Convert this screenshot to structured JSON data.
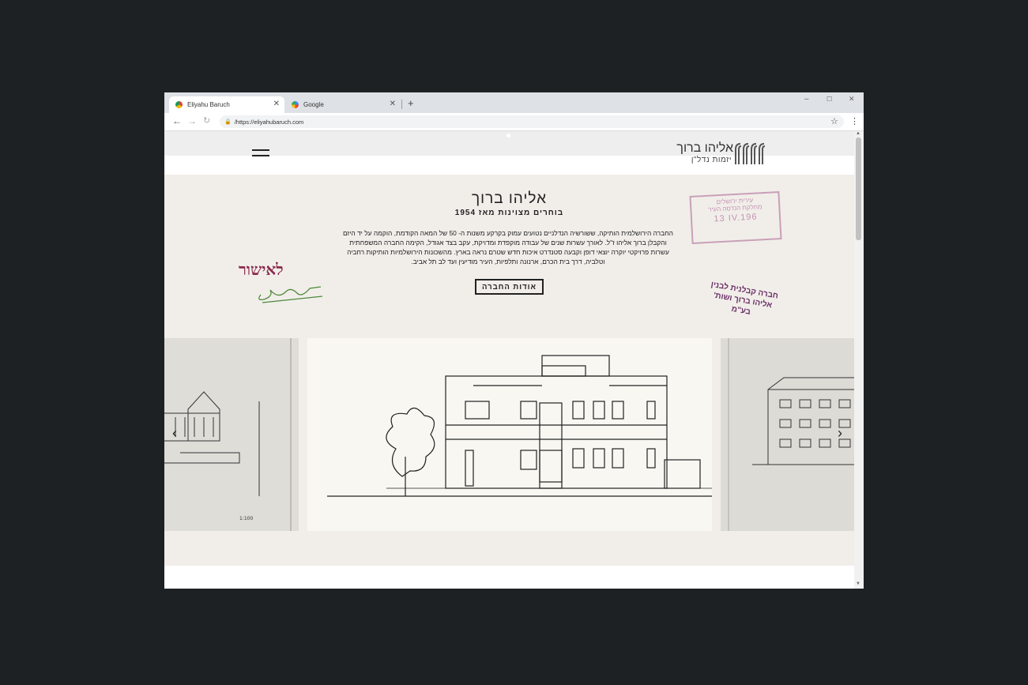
{
  "browser": {
    "tabs": [
      {
        "label": "Eliyahu Baruch",
        "active": true,
        "favicon": "chrome-icon"
      },
      {
        "label": "Google",
        "active": false,
        "favicon": "google-icon"
      }
    ],
    "new_tab": "+",
    "url": "/https://eliyahubaruch.com",
    "window_controls": {
      "minimize": "–",
      "maximize": "☐",
      "close": "✕"
    }
  },
  "site": {
    "logo": {
      "name": "אליהו ברוך",
      "subtitle": "יזמות נדל\"ן"
    },
    "hero": {
      "title": "אליהו ברוך",
      "tagline": "בוחרים מצוינות מאז 1954",
      "body": "החברה הירושלמית הותיקה, ששורשיה הנדלניים נטועים עמוק בקרקע משנות ה- 50 של המאה הקודמת, הוקמה על יד היזם והקבלן ברוך אליהו ז\"ל. לאורך עשרות שנים של עבודה מוקפדת ומדויקת, עקב בצד אגודל, הקימה החברה המשפחתית עשרות פרויקטי יוקרה יוצאי דופן וקבעה סטנדרט איכות חדש שטרם נראה בארץ. מהשכונות הירושלמיות הותיקות רחביה וטלביה, דרך בית הכרם, ארנונה ותלפיות, העיר מודיעין ועד לב תל אביב.",
      "button": "אודות החברה"
    },
    "stamps": {
      "date_stamp": {
        "line1": "עירית ירושלים",
        "line2": "מחלקת הנדסה העיר",
        "date": "13 IV.196"
      },
      "company_stamp": {
        "line1": "חברה קבלנית לבנין",
        "line2": "אליהו ברוך ושות' בע\"מ"
      },
      "signature_word": "לאישור"
    },
    "carousel": {
      "prev": "‹",
      "next": "›"
    }
  },
  "colors": {
    "page_bg": "#1e2124",
    "hero_bg": "#f1eeea",
    "stamp_pink": "#c593b3",
    "stamp_purple": "#6b2f66"
  }
}
